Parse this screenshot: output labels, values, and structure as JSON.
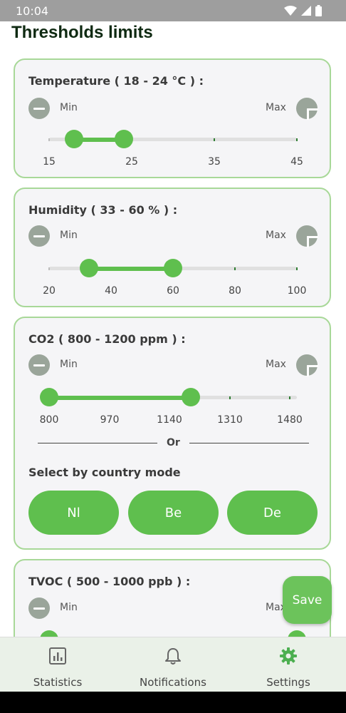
{
  "status": {
    "time": "10:04"
  },
  "page": {
    "title": "Thresholds limits"
  },
  "labels": {
    "min": "Min",
    "max": "Max"
  },
  "temperature": {
    "title": "Temperature ( 18 - 24 °C ) :",
    "low": 18,
    "high": 24,
    "ticks": [
      "15",
      "25",
      "35",
      "45"
    ]
  },
  "humidity": {
    "title": "Humidity ( 33 - 60 % ) :",
    "low": 33,
    "high": 60,
    "ticks": [
      "20",
      "40",
      "60",
      "80",
      "100"
    ]
  },
  "co2": {
    "title": "CO2 ( 800 - 1200 ppm ) :",
    "low": 800,
    "high": 1200,
    "ticks": [
      "800",
      "970",
      "1140",
      "1310",
      "1480"
    ],
    "or_text": "Or",
    "country_title": "Select by country mode",
    "modes": [
      "Nl",
      "Be",
      "De"
    ]
  },
  "tvoc": {
    "title": "TVOC ( 500 - 1000 ppb ) :"
  },
  "fab": {
    "label": "Save"
  },
  "nav": {
    "statistics": "Statistics",
    "notifications": "Notifications",
    "settings": "Settings"
  },
  "colors": {
    "accent": "#5fbf4e",
    "card_border": "#a8d898",
    "nav_active": "#4caf50"
  },
  "icons": [
    "wifi-icon",
    "signal-icon",
    "battery-icon",
    "minus-icon",
    "plus-icon",
    "bar-chart-icon",
    "bell-icon",
    "gear-icon"
  ]
}
